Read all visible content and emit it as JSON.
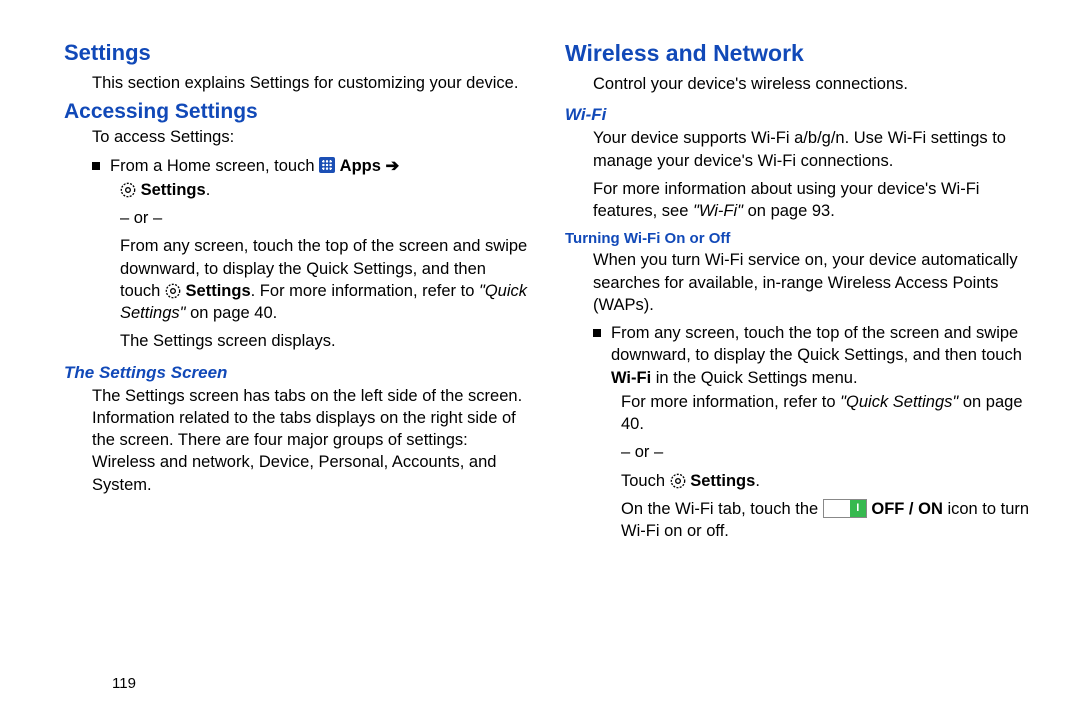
{
  "left": {
    "h1": "Settings",
    "intro": "This section explains Settings for customizing your device.",
    "h2": "Accessing Settings",
    "to_access": "To access Settings:",
    "b1_a": "From a Home screen, touch ",
    "b1_apps": "Apps",
    "b1_arrow": " ➔",
    "b1_settings": "Settings",
    "b1_period": ".",
    "or": "– or –",
    "swipe1": "From any screen, touch the top of the screen and swipe downward, to display the Quick Settings, and then touch ",
    "swipe_settings": "Settings",
    "swipe2": ". For more information, refer to ",
    "qs_ref": "\"Quick Settings\"",
    "swipe3": " on page 40.",
    "displays": "The Settings screen displays.",
    "h3": "The Settings Screen",
    "ss_body": "The Settings screen has tabs on the left side of the screen. Information related to the tabs displays on the right side of the screen. There are four major groups of settings: Wireless and network, Device, Personal, Accounts, and System."
  },
  "right": {
    "h1": "Wireless and Network",
    "intro": "Control your device's wireless connections.",
    "h3_wifi": "Wi-Fi",
    "wifi_p1": "Your device supports Wi-Fi a/b/g/n. Use Wi-Fi settings to manage your device's Wi-Fi connections.",
    "wifi_p2a": "For more information about using your device's Wi-Fi features, see ",
    "wifi_ref": "\"Wi-Fi\"",
    "wifi_p2b": " on page 93.",
    "h4_turn": "Turning Wi-Fi On or Off",
    "turn_p1": "When you turn Wi-Fi service on, your device automatically searches for available, in-range Wireless Access Points (WAPs).",
    "b1_a": "From any screen, touch the top of the screen and swipe downward, to display the Quick Settings, and then touch ",
    "b1_wifi": "Wi-Fi",
    "b1_b": " in the Quick Settings menu.",
    "more_a": "For more information, refer to ",
    "more_ref": "\"Quick Settings\"",
    "more_b": " on page 40.",
    "or": "– or –",
    "touch": "Touch ",
    "touch_settings": "Settings",
    "touch_period": ".",
    "wifi_tab_a": "On the Wi-Fi tab, touch the ",
    "offon": "OFF / ON",
    "wifi_tab_b": " icon to turn Wi-Fi on or off."
  },
  "page_number": "119"
}
